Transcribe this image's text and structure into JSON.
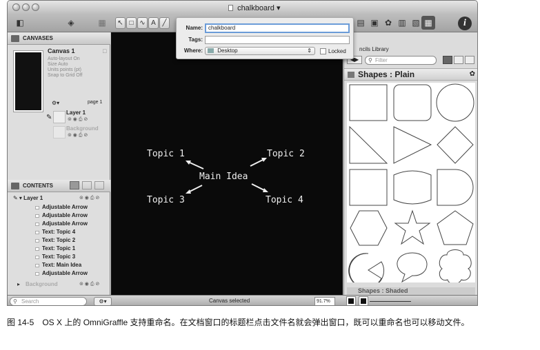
{
  "window": {
    "title": "chalkboard",
    "title_arrow": "▾"
  },
  "left_panel": {
    "canvases_header": "CANVASES",
    "canvas_name": "Canvas 1",
    "canvas_props": [
      "Auto-layout On",
      "Size Auto",
      "Units points (pt)",
      "Snap to Grid Off"
    ],
    "page_label": "page 1",
    "layers": [
      {
        "name": "Layer 1",
        "muted": false
      },
      {
        "name": "Background",
        "muted": true
      }
    ],
    "contents_header": "CONTENTS",
    "tree_root": "Layer 1",
    "tree_items": [
      "Adjustable Arrow",
      "Adjustable Arrow",
      "Adjustable Arrow",
      "Text: Topic 4",
      "Text: Topic 2",
      "Text: Topic 1",
      "Text: Topic 3",
      "Text: Main Idea",
      "Adjustable Arrow"
    ],
    "tree_background": "Background"
  },
  "canvas": {
    "main_idea": "Main Idea",
    "topic1": "Topic 1",
    "topic2": "Topic 2",
    "topic3": "Topic 3",
    "topic4": "Topic 4"
  },
  "right_panel": {
    "stencils_label": "ncils Library",
    "filter_placeholder": "Filter",
    "shapes_title": "Shapes : Plain",
    "next_section": "Shapes : Shaded"
  },
  "popover": {
    "name_label": "Name:",
    "name_value": "chalkboard",
    "tags_label": "Tags:",
    "tags_value": "",
    "where_label": "Where:",
    "where_value": "Desktop",
    "locked_label": "Locked"
  },
  "status_bar": {
    "search_placeholder": "Search",
    "status_text": "Canvas selected",
    "zoom": "91.7%"
  },
  "caption": "图 14-5　OS X 上的 OmniGraffle 支持重命名。在文档窗口的标题栏点击文件名就会弹出窗口，既可以重命名也可以移动文件。"
}
